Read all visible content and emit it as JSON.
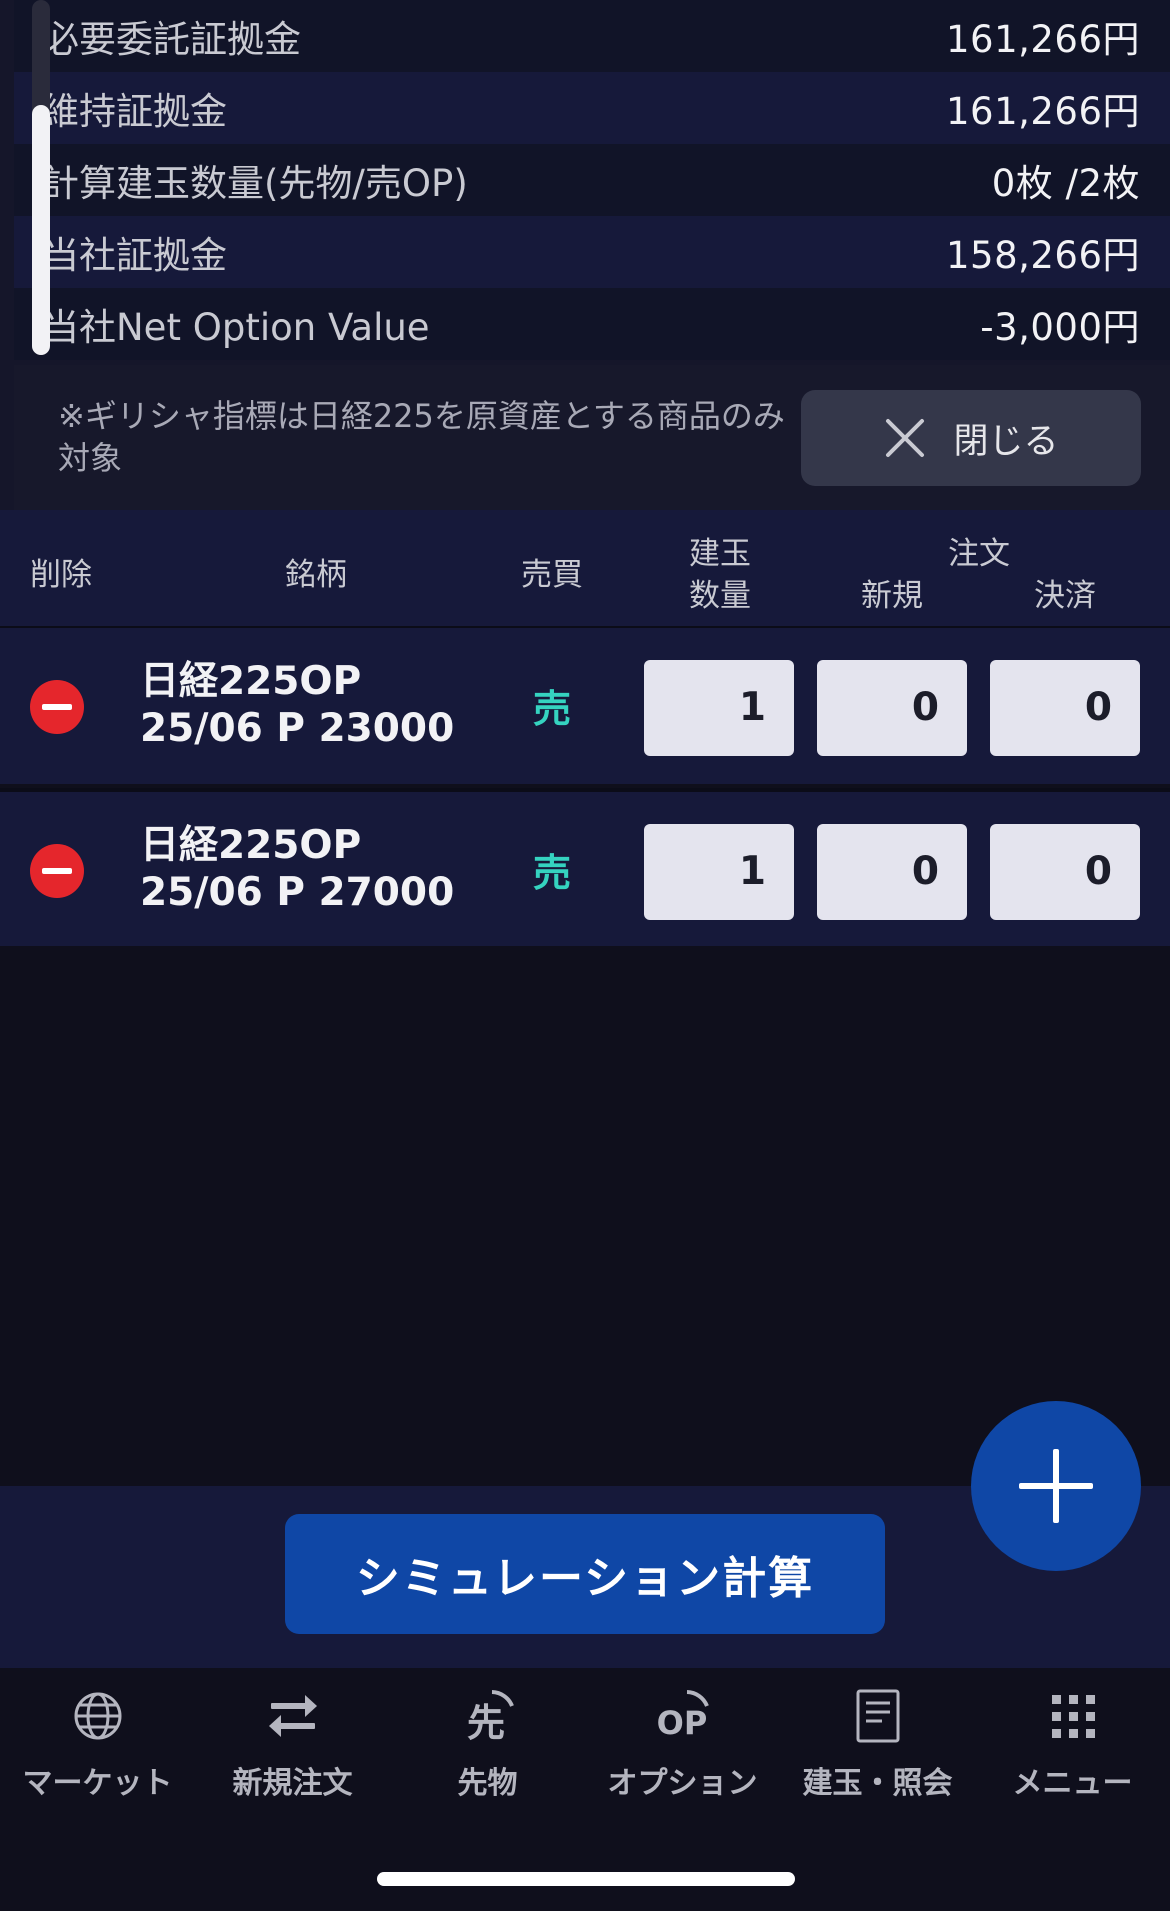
{
  "summary": {
    "rows": [
      {
        "label": "必要委託証拠金",
        "value": "161,266円"
      },
      {
        "label": "維持証拠金",
        "value": "161,266円"
      },
      {
        "label": "計算建玉数量(先物/売OP)",
        "value": "0枚 /2枚"
      },
      {
        "label": "当社証拠金",
        "value": "158,266円"
      },
      {
        "label": "当社Net Option Value",
        "value": "-3,000円"
      }
    ],
    "note": "※ギリシャ指標は日経225を原資産とする商品のみ対象",
    "close_label": "閉じる"
  },
  "table": {
    "headers": {
      "delete": "削除",
      "instrument": "銘柄",
      "side": "売買",
      "position_line1": "建玉",
      "position_line2": "数量",
      "order": "注文",
      "new": "新規",
      "settle": "決済"
    },
    "rows": [
      {
        "name_line1": "日経225OP",
        "name_line2": "25/06 P 23000",
        "side": "売",
        "position": "1",
        "new": "0",
        "settle": "0"
      },
      {
        "name_line1": "日経225OP",
        "name_line2": "25/06 P 27000",
        "side": "売",
        "position": "1",
        "new": "0",
        "settle": "0"
      }
    ]
  },
  "simulation_button": "シミュレーション計算",
  "tabs": [
    {
      "label": "マーケット",
      "icon": "globe-icon"
    },
    {
      "label": "新規注文",
      "icon": "swap-arrows-icon"
    },
    {
      "label": "先物",
      "icon": "futures-icon"
    },
    {
      "label": "オプション",
      "icon": "option-icon"
    },
    {
      "label": "建玉・照会",
      "icon": "document-icon"
    },
    {
      "label": "メニュー",
      "icon": "grid-menu-icon"
    }
  ],
  "colors": {
    "accent": "#0f47a6",
    "sell": "#35d3c0",
    "delete": "#e5262c"
  }
}
